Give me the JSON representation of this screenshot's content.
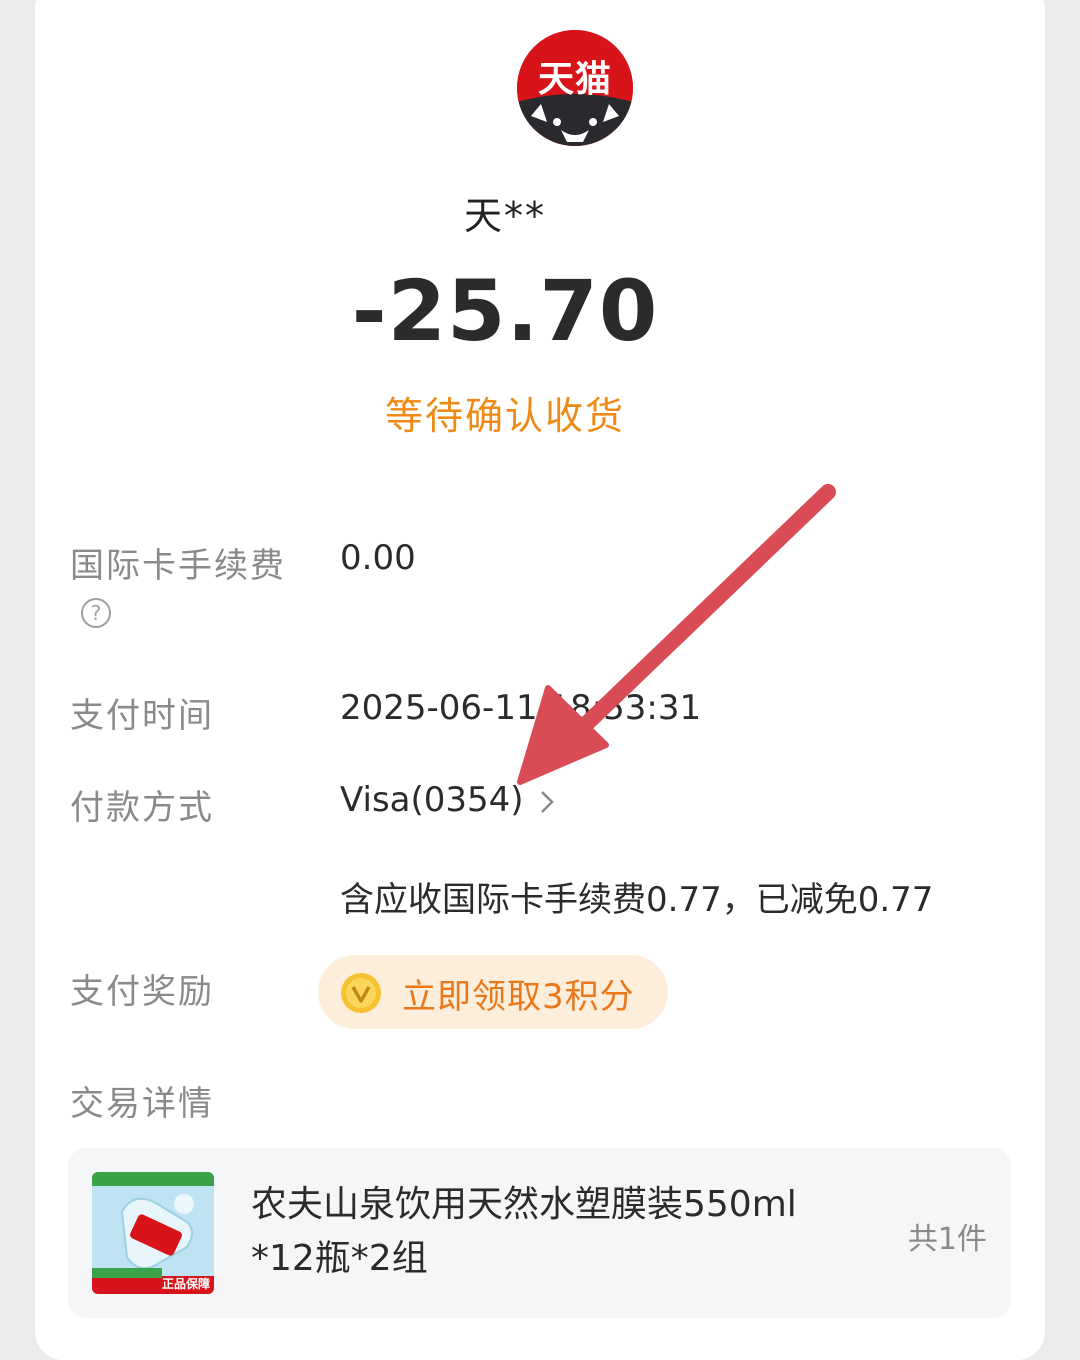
{
  "merchant": {
    "name": "天**",
    "logo_text": "天猫"
  },
  "amount": "-25.70",
  "status": "等待确认收货",
  "details": {
    "intl_fee_label": "国际卡手续费",
    "intl_fee_value": "0.00",
    "pay_time_label": "支付时间",
    "pay_time_value": "2025-06-11 18:53:31",
    "pay_method_label": "付款方式",
    "pay_method_value": "Visa(0354)",
    "fee_note": "含应收国际卡手续费0.77，已减免0.77",
    "reward_label": "支付奖励",
    "reward_button": "立即领取3积分",
    "trade_label": "交易详情"
  },
  "product": {
    "name": "农夫山泉饮用天然水塑膜装550ml *12瓶*2组",
    "quantity": "共1件",
    "thumb_badge": "正品保障"
  },
  "colors": {
    "accent_orange": "#f08a16",
    "annotation_arrow": "#d94b55",
    "brand_red": "#d8141b"
  }
}
